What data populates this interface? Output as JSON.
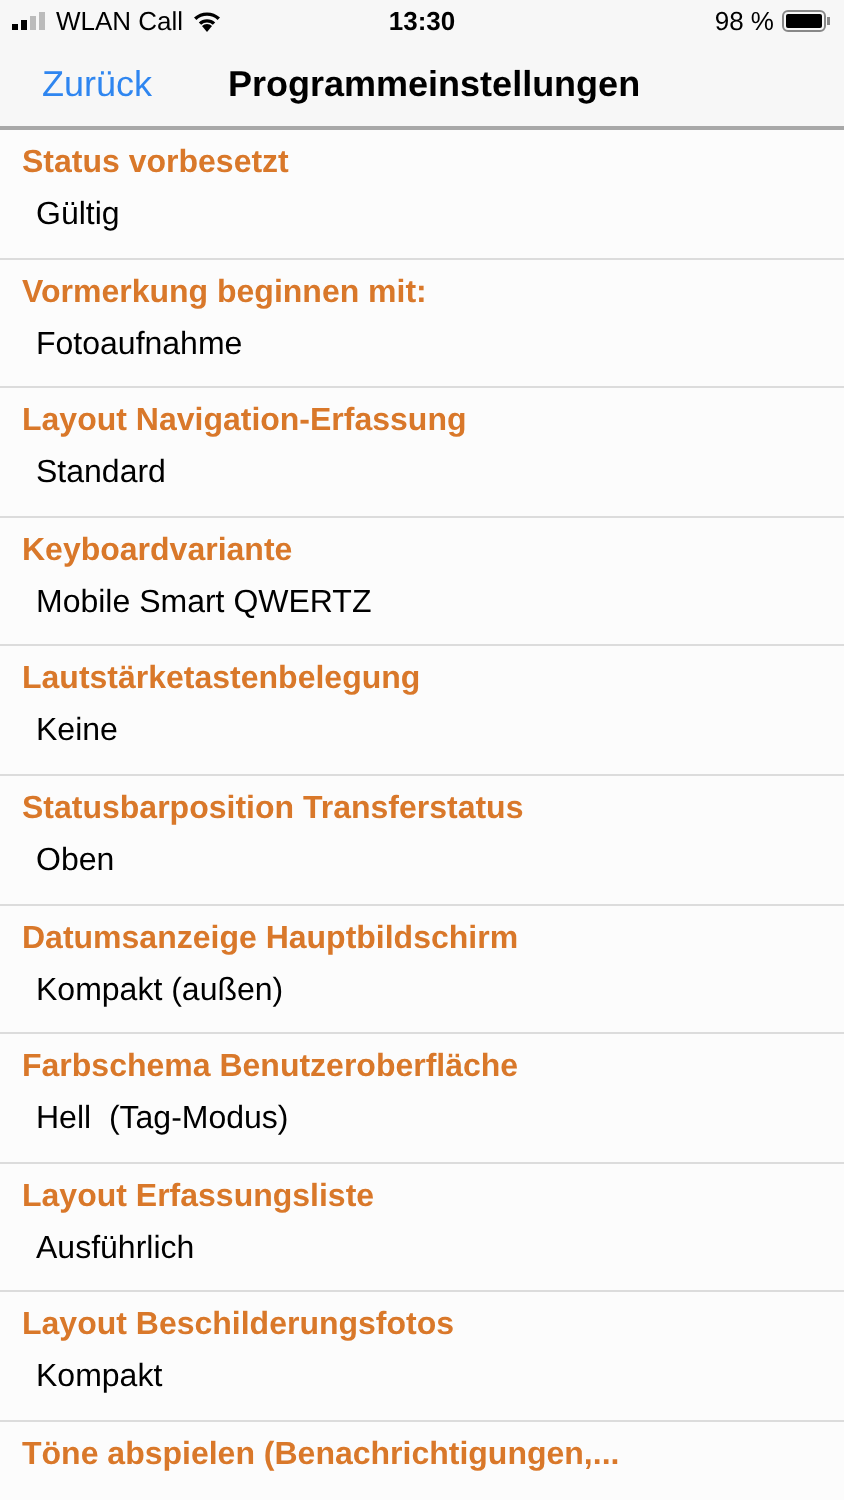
{
  "status_bar": {
    "carrier": "WLAN Call",
    "time": "13:30",
    "battery": "98 %"
  },
  "nav": {
    "back": "Zurück",
    "title": "Programmeinstellungen"
  },
  "settings": [
    {
      "label": "Status vorbesetzt",
      "value": "Gültig"
    },
    {
      "label": "Vormerkung beginnen mit:",
      "value": "Fotoaufnahme"
    },
    {
      "label": "Layout Navigation-Erfassung",
      "value": "Standard"
    },
    {
      "label": "Keyboardvariante",
      "value": "Mobile Smart QWERTZ"
    },
    {
      "label": "Lautstärketastenbelegung",
      "value": "Keine"
    },
    {
      "label": "Statusbarposition Transferstatus",
      "value": "Oben"
    },
    {
      "label": "Datumsanzeige Hauptbildschirm",
      "value": "Kompakt (außen)"
    },
    {
      "label": "Farbschema Benutzeroberfläche",
      "value": "Hell  (Tag-Modus)"
    },
    {
      "label": "Layout Erfassungsliste",
      "value": "Ausführlich"
    },
    {
      "label": "Layout Beschilderungsfotos",
      "value": "Kompakt"
    },
    {
      "label": "Töne abspielen (Benachrichtigungen,..."
    }
  ]
}
